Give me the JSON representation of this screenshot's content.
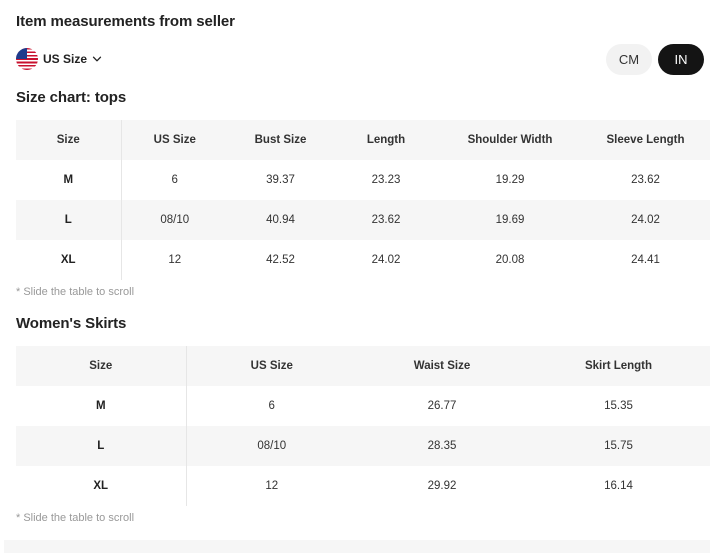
{
  "main_title": "Item measurements from seller",
  "size_selector": {
    "label": "US Size",
    "flag_icon": "us-flag-icon",
    "chevron_icon": "chevron-down-icon"
  },
  "unit_toggle": {
    "options": [
      "CM",
      "IN"
    ],
    "selected": "IN"
  },
  "tops": {
    "title": "Size chart: tops",
    "headers": [
      "Size",
      "US Size",
      "Bust Size",
      "Length",
      "Shoulder Width",
      "Sleeve Length"
    ],
    "rows": [
      [
        "M",
        "6",
        "39.37",
        "23.23",
        "19.29",
        "23.62"
      ],
      [
        "L",
        "08/10",
        "40.94",
        "23.62",
        "19.69",
        "24.02"
      ],
      [
        "XL",
        "12",
        "42.52",
        "24.02",
        "20.08",
        "24.41"
      ]
    ],
    "hint": "* Slide the table to scroll"
  },
  "skirts": {
    "title": "Women's Skirts",
    "headers": [
      "Size",
      "US Size",
      "Waist Size",
      "Skirt Length"
    ],
    "rows": [
      [
        "M",
        "6",
        "26.77",
        "15.35"
      ],
      [
        "L",
        "08/10",
        "28.35",
        "15.75"
      ],
      [
        "XL",
        "12",
        "29.92",
        "16.14"
      ]
    ],
    "hint": "* Slide the table to scroll"
  },
  "colors": {
    "accent": "#141414",
    "row_shade": "#f6f6f6",
    "hint": "#999999"
  }
}
